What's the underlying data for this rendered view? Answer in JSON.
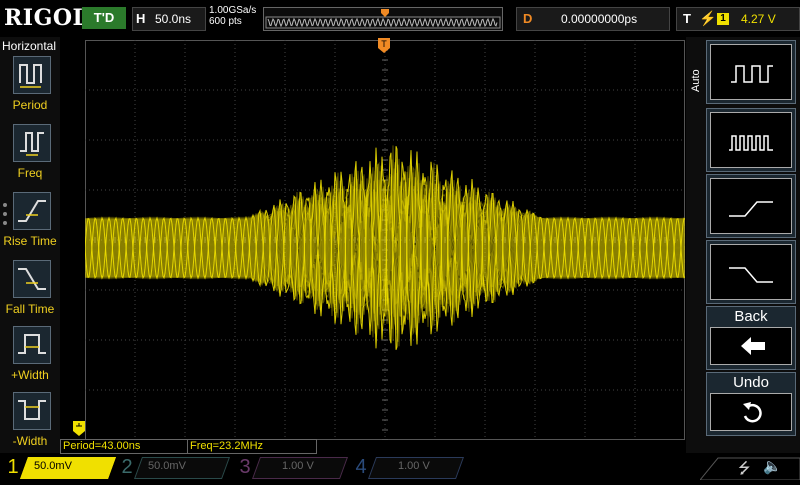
{
  "header": {
    "logo": "RIGOL",
    "run_state": "T'D",
    "timebase": {
      "label": "H",
      "value": "50.0ns"
    },
    "sample": {
      "rate": "1.00GSa/s",
      "points": "600 pts"
    },
    "delay": {
      "label": "D",
      "value": "0.00000000ps"
    },
    "trigger": {
      "label": "T",
      "source": "1",
      "level": "4.27 V"
    }
  },
  "left_menu": {
    "title": "Horizontal",
    "items": [
      {
        "label": "Period",
        "icon": "period-icon"
      },
      {
        "label": "Freq",
        "icon": "frequency-icon"
      },
      {
        "label": "Rise Time",
        "icon": "rise-time-icon"
      },
      {
        "label": "Fall Time",
        "icon": "fall-time-icon"
      },
      {
        "label": "+Width",
        "icon": "positive-width-icon"
      },
      {
        "label": "-Width",
        "icon": "negative-width-icon"
      }
    ]
  },
  "right_menu": {
    "tab_label": "Auto",
    "items": [
      {
        "icon": "square-wave-icon"
      },
      {
        "icon": "pulse-train-icon"
      },
      {
        "icon": "rising-edge-icon"
      },
      {
        "icon": "falling-edge-icon"
      }
    ],
    "back_label": "Back",
    "undo_label": "Undo"
  },
  "measurements": {
    "period": "Period=43.00ns",
    "freq": "Freq=23.2MHz"
  },
  "channels": [
    {
      "num": "1",
      "scale": "50.0mV",
      "color": "#f0e000",
      "active": true
    },
    {
      "num": "2",
      "scale": "50.0mV",
      "color": "#00c0c0",
      "active": false
    },
    {
      "num": "3",
      "scale": "1.00 V",
      "color": "#e040e0",
      "active": false
    },
    {
      "num": "4",
      "scale": "1.00 V",
      "color": "#2080ff",
      "active": false
    }
  ],
  "colors": {
    "accent": "#f0e000",
    "trigger": "#f08a24"
  }
}
